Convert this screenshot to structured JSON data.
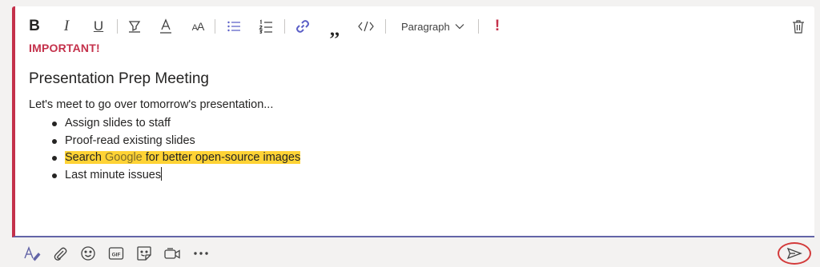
{
  "toolbar": {
    "paragraph_label": "Paragraph",
    "icons": [
      "bold-icon",
      "italic-icon",
      "underline-icon",
      "highlight-icon",
      "font-color-icon",
      "font-size-icon",
      "bulleted-list-icon",
      "numbered-list-icon",
      "link-icon",
      "quote-icon",
      "code-icon",
      "chevron-down-icon",
      "important-icon",
      "delete-icon"
    ]
  },
  "message": {
    "important_label": "IMPORTANT!",
    "heading": "Presentation Prep Meeting",
    "intro": "Let's meet to go over tomorrow's presentation...",
    "bullets": [
      "Assign slides to staff",
      "Proof-read existing slides",
      "Search ",
      "Last minute issues"
    ],
    "bullet3_link": "Google",
    "bullet3_rest": " for better open-source images"
  },
  "colors": {
    "important_red": "#c4314b",
    "accent_purple": "#6264a7",
    "highlight_yellow": "#ffd335",
    "send_annotation_red": "#d33a3a"
  },
  "bottom_bar": {
    "icons": [
      "format-icon",
      "attach-icon",
      "emoji-icon",
      "gif-icon",
      "sticker-icon",
      "meet-now-icon",
      "more-options-icon",
      "send-icon"
    ]
  }
}
